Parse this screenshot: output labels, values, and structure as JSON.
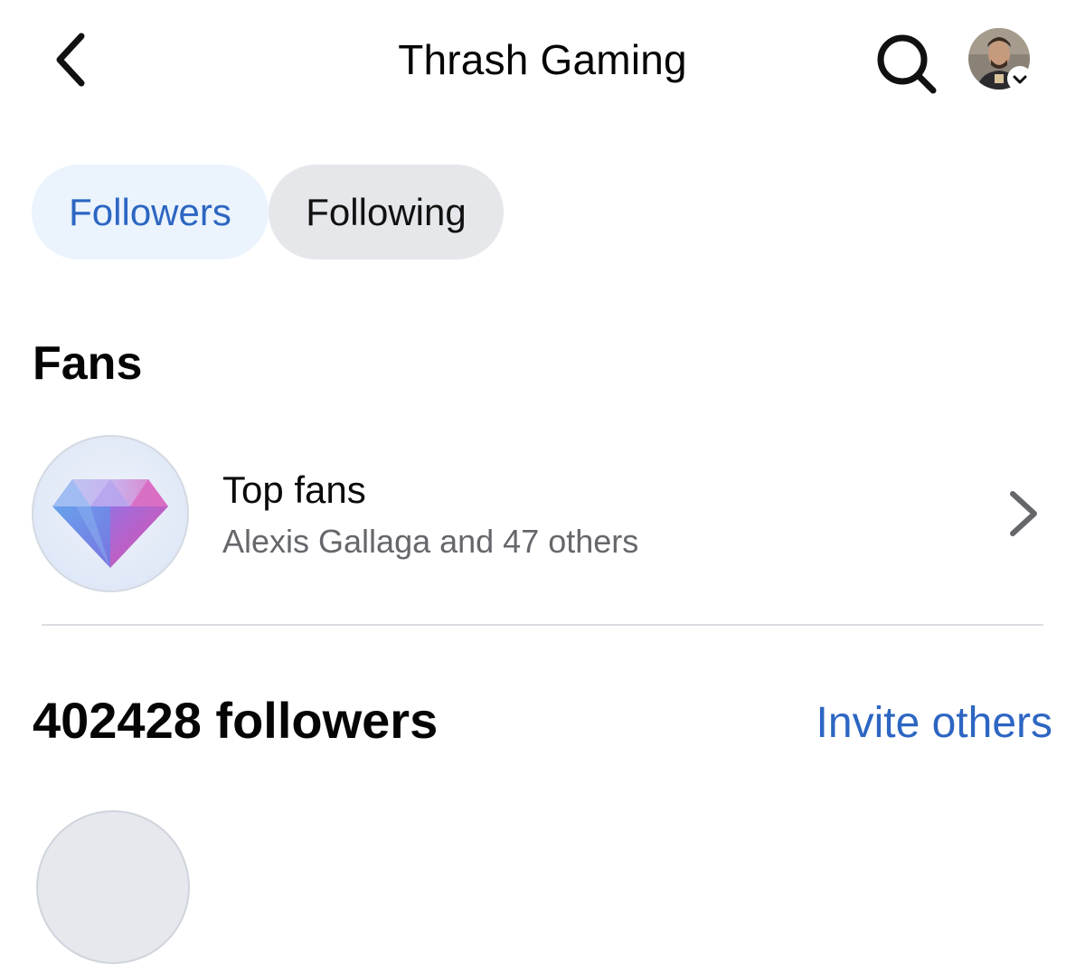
{
  "header": {
    "title": "Thrash Gaming",
    "back_icon": "chevron-left-icon",
    "search_icon": "search-icon",
    "account_icon": "profile-avatar"
  },
  "tabs": [
    {
      "label": "Followers",
      "selected": true
    },
    {
      "label": "Following",
      "selected": false
    }
  ],
  "fans": {
    "section_title": "Fans",
    "top_fans": {
      "title": "Top fans",
      "subtitle": "Alexis Gallaga and 47 others",
      "icon": "diamond-icon"
    }
  },
  "followers": {
    "count_label": "402428 followers",
    "invite_label": "Invite others"
  },
  "colors": {
    "accent": "#2d66c2",
    "selected_tab_bg": "#ebf4fd",
    "tab_bg": "#e5e7eb",
    "secondary_text": "#65676b",
    "divider": "#dcdde1"
  }
}
